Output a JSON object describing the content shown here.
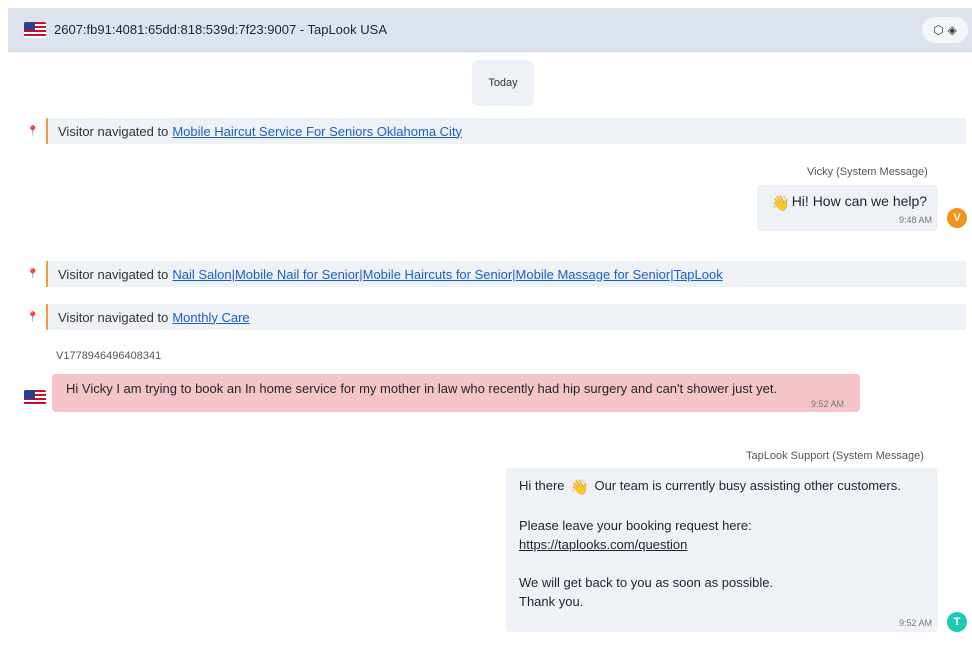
{
  "header": {
    "title": "2607:fb91:4081:65dd:818:539d:7f23:9007 - TapLook USA",
    "flag_icon": "us-flag-icon",
    "actions": [
      "tag-icon",
      "bookmark-icon"
    ]
  },
  "day_separator": "Today",
  "events": [
    {
      "prefix": "Visitor navigated to",
      "link": "Mobile Haircut Service For Seniors Oklahoma City"
    },
    {
      "prefix": "Visitor navigated to",
      "link": "Nail Salon|Mobile Nail for Senior|Mobile Haircuts for Senior|Mobile Massage for Senior|TapLook"
    },
    {
      "prefix": "Visitor navigated to",
      "link": "Monthly Care"
    }
  ],
  "messages": {
    "vicky": {
      "sender": "Vicky (System Message)",
      "text": "Hi! How can we help?",
      "time": "9:48 AM",
      "avatar": "V",
      "avatar_color": "#f2911b"
    },
    "visitor": {
      "id": "V1778946496408341",
      "text": "Hi Vicky I am trying to book an In home service for my mother in law who recently had hip surgery and can't shower just yet.",
      "time": "9:52 AM",
      "highlight_color": "#f4c4c8"
    },
    "support": {
      "sender": "TapLook Support (System Message)",
      "line1_before": "Hi there",
      "line1_after": "Our team is currently busy assisting other customers.",
      "line2": "Please leave your booking request here:",
      "link": "https://taplooks.com/question",
      "line3": "We will get back to you as soon as possible.",
      "line4": "Thank you.",
      "time": "9:52 AM",
      "avatar": "T",
      "avatar_color": "#1ec9b8"
    }
  },
  "colors": {
    "header_bg": "#dde3ec",
    "bubble_bg": "#eef1f5",
    "event_accent": "#f29b4a",
    "link": "#1b5ec7"
  }
}
